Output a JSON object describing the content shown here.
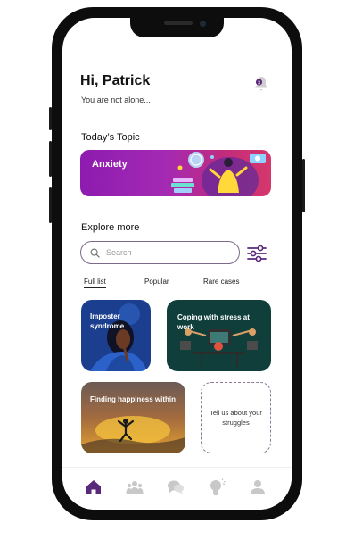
{
  "header": {
    "greeting": "Hi, Patrick",
    "subtitle": "You are not alone..."
  },
  "topic": {
    "section_title": "Today’s Topic",
    "card_label": "Anxiety"
  },
  "explore": {
    "section_title": "Explore more",
    "search_placeholder": "Search"
  },
  "tabs": [
    {
      "label": "Full list",
      "active": true
    },
    {
      "label": "Popular",
      "active": false
    },
    {
      "label": "Rare cases",
      "active": false
    }
  ],
  "cards": [
    {
      "label": "Imposter syndrome"
    },
    {
      "label": "Coping with stress at work"
    },
    {
      "label": "Finding happiness within"
    },
    {
      "label": "Tell us about your struggles"
    }
  ],
  "nav": [
    {
      "icon": "home-icon",
      "active": true
    },
    {
      "icon": "community-icon",
      "active": false
    },
    {
      "icon": "chat-icon",
      "active": false
    },
    {
      "icon": "idea-icon",
      "active": false
    },
    {
      "icon": "profile-icon",
      "active": false
    }
  ],
  "colors": {
    "accent": "#5a2a7a",
    "topic_gradient_start": "#8e1bb0",
    "topic_gradient_end": "#d6386b",
    "inactive_icon": "#c8c8c8"
  }
}
